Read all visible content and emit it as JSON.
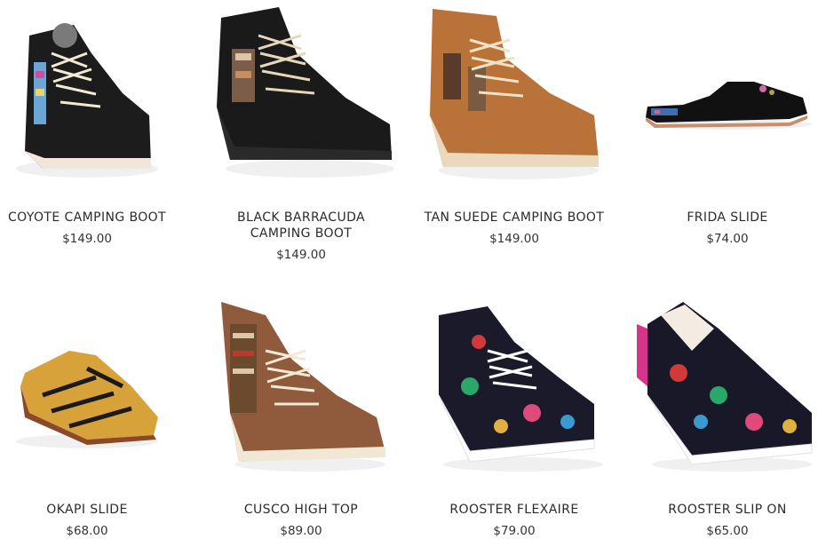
{
  "products": [
    {
      "name": "COYOTE CAMPING BOOT",
      "price": "$149.00",
      "image": "black-high-top-camping-boot"
    },
    {
      "name": "BLACK BARRACUDA CAMPING BOOT",
      "price": "$149.00",
      "image": "black-leather-camping-boot"
    },
    {
      "name": "TAN SUEDE CAMPING BOOT",
      "price": "$149.00",
      "image": "tan-suede-camping-boot"
    },
    {
      "name": "FRIDA SLIDE",
      "price": "$74.00",
      "image": "black-velvet-slide"
    },
    {
      "name": "OKAPI SLIDE",
      "price": "$68.00",
      "image": "striped-mule-slide"
    },
    {
      "name": "CUSCO HIGH TOP",
      "price": "$89.00",
      "image": "brown-textile-high-top"
    },
    {
      "name": "ROOSTER FLEXAIRE",
      "price": "$79.00",
      "image": "floral-running-sneaker"
    },
    {
      "name": "ROOSTER SLIP ON",
      "price": "$65.00",
      "image": "floral-slip-on"
    }
  ]
}
